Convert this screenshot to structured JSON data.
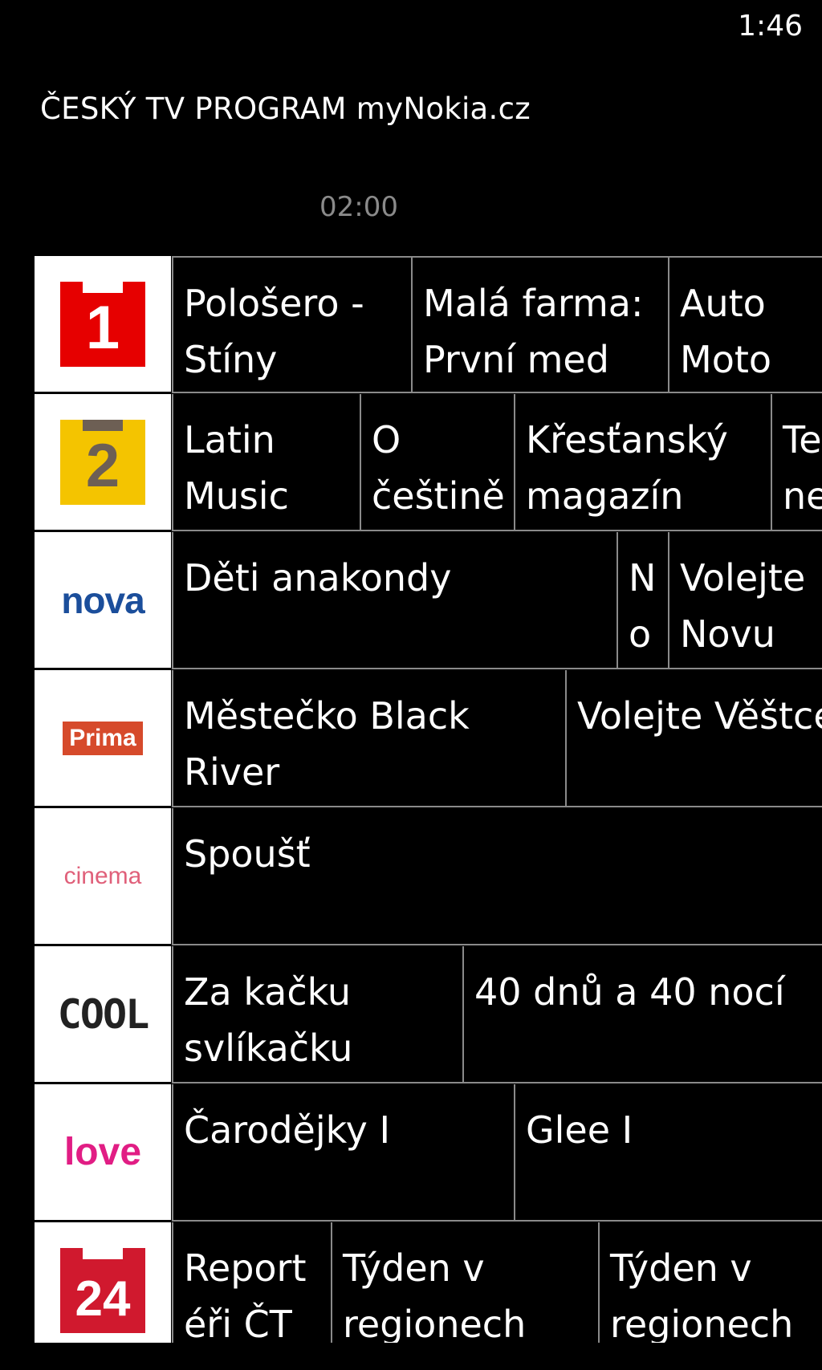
{
  "status": {
    "time": "1:46"
  },
  "app": {
    "title": "ČESKÝ TV PROGRAM myNokia.cz"
  },
  "timeline": {
    "current_marker": "02:00"
  },
  "channels": [
    {
      "logo": {
        "name": "ct1-logo",
        "text": "1",
        "color": "#e60000"
      },
      "programs": [
        {
          "title": "Pološero - Stíny města"
        },
        {
          "title": "Malá farma: První med"
        },
        {
          "title": "Auto Moto Revue"
        }
      ]
    },
    {
      "logo": {
        "name": "ct2-logo",
        "text": "2",
        "color": "#f4c400"
      },
      "programs": [
        {
          "title": "Latin Music"
        },
        {
          "title": "O češtině"
        },
        {
          "title": "Křesťanský magazín"
        },
        {
          "title": "Televize neslyšících"
        }
      ]
    },
    {
      "logo": {
        "name": "nova-logo",
        "text": "nova",
        "color": "#1b4e9b"
      },
      "programs": [
        {
          "title": "Děti anakondy"
        },
        {
          "title": "No"
        },
        {
          "title": "Volejte Novu"
        }
      ]
    },
    {
      "logo": {
        "name": "prima-family-logo",
        "text": "Prima",
        "color": "#d64a2b"
      },
      "programs": [
        {
          "title": "Městečko Black River"
        },
        {
          "title": "Volejte Věštce"
        }
      ]
    },
    {
      "logo": {
        "name": "nova-cinema-logo",
        "text": "cinema",
        "color": "#e0607a"
      },
      "programs": [
        {
          "title": "Spoušť"
        }
      ]
    },
    {
      "logo": {
        "name": "prima-cool-logo",
        "text": "COOL",
        "color": "#222222"
      },
      "programs": [
        {
          "title": "Za kačku svlíkačku"
        },
        {
          "title": "40 dnů a 40 nocí"
        }
      ]
    },
    {
      "logo": {
        "name": "prima-love-logo",
        "text": "love",
        "color": "#e11d84"
      },
      "programs": [
        {
          "title": "Čarodějky I"
        },
        {
          "title": "Glee I"
        }
      ]
    },
    {
      "logo": {
        "name": "ct24-logo",
        "text": "24",
        "color": "#d0192e"
      },
      "programs": [
        {
          "title": "Report éři ČT"
        },
        {
          "title": "Týden v regionech"
        },
        {
          "title": "Týden v regionech"
        }
      ]
    }
  ]
}
